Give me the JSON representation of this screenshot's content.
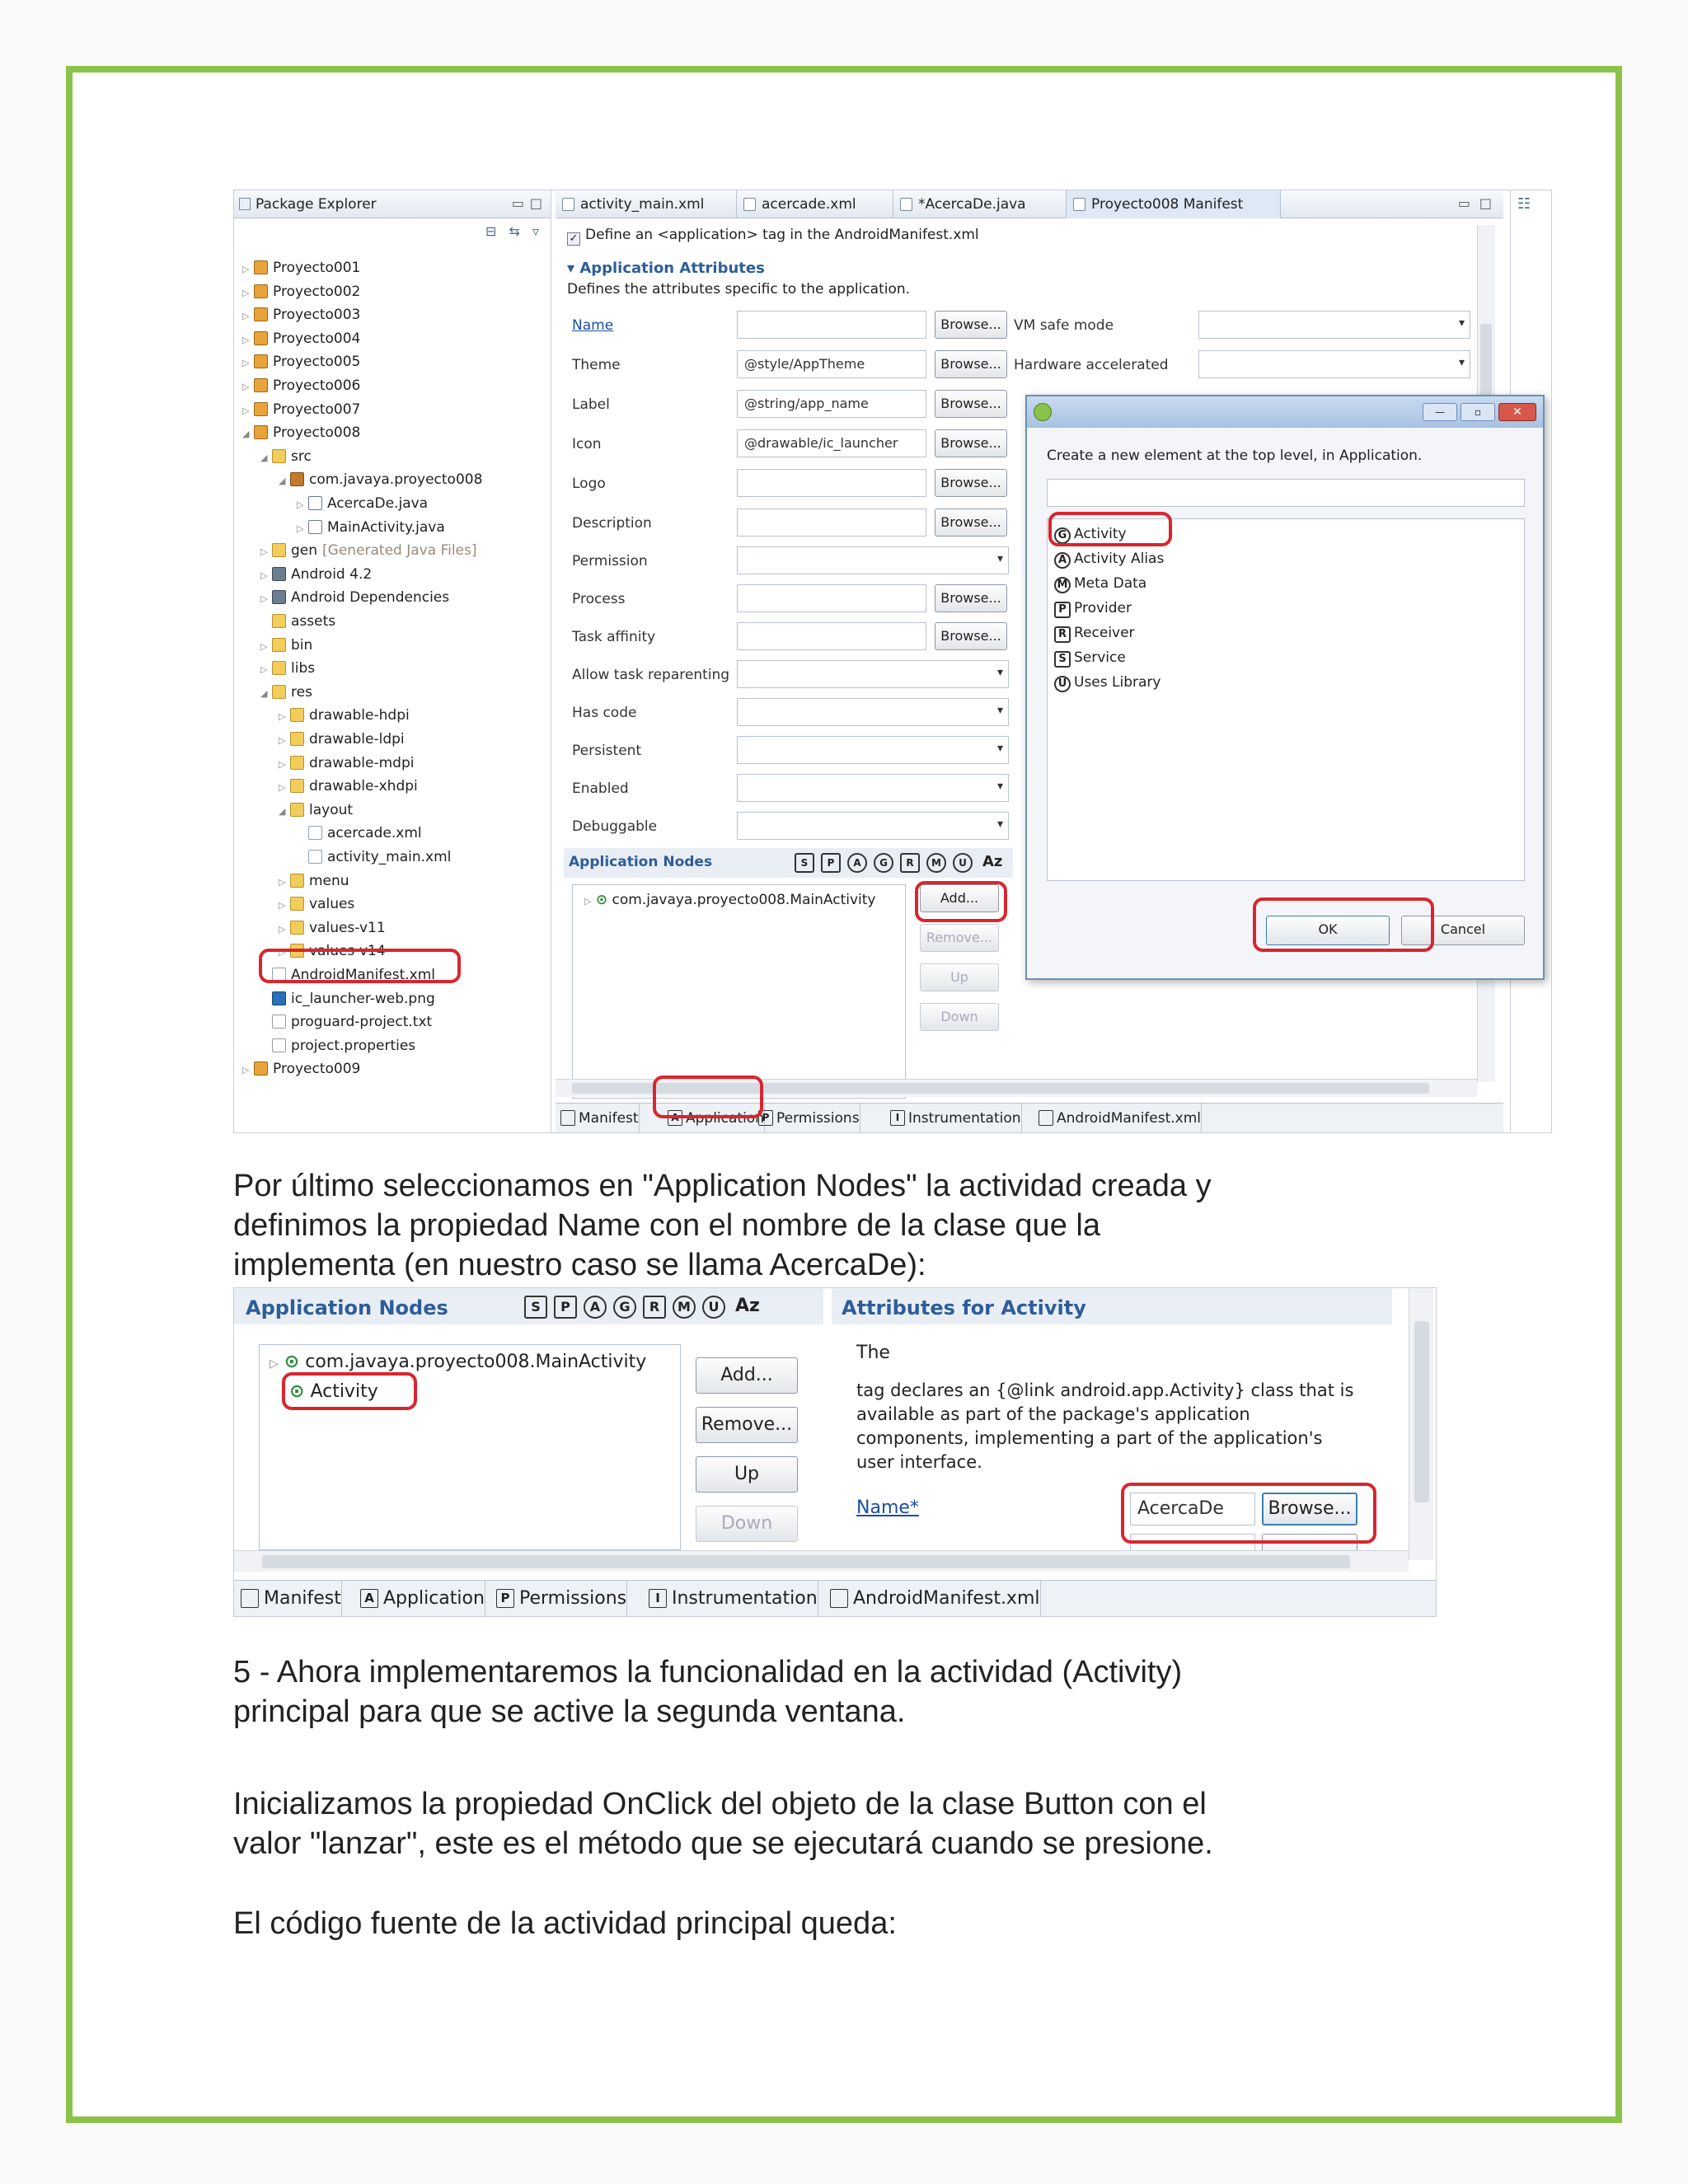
{
  "screenshot1": {
    "package_explorer": {
      "title": "Package Explorer",
      "tree": [
        {
          "label": "Proyecto001",
          "icon": "project-icon",
          "indent": 0,
          "twisty": "▷"
        },
        {
          "label": "Proyecto002",
          "icon": "project-icon",
          "indent": 0,
          "twisty": "▷"
        },
        {
          "label": "Proyecto003",
          "icon": "project-icon",
          "indent": 0,
          "twisty": "▷"
        },
        {
          "label": "Proyecto004",
          "icon": "project-icon",
          "indent": 0,
          "twisty": "▷"
        },
        {
          "label": "Proyecto005",
          "icon": "project-icon",
          "indent": 0,
          "twisty": "▷"
        },
        {
          "label": "Proyecto006",
          "icon": "project-icon",
          "indent": 0,
          "twisty": "▷"
        },
        {
          "label": "Proyecto007",
          "icon": "project-icon",
          "indent": 0,
          "twisty": "▷"
        },
        {
          "label": "Proyecto008",
          "icon": "project-icon",
          "indent": 0,
          "twisty": "◢"
        },
        {
          "label": "src",
          "icon": "folder-icon",
          "indent": 1,
          "twisty": "◢"
        },
        {
          "label": "com.javaya.proyecto008",
          "icon": "package-icon",
          "indent": 2,
          "twisty": "◢"
        },
        {
          "label": "AcercaDe.java",
          "icon": "java-file-icon",
          "indent": 3,
          "twisty": "▷"
        },
        {
          "label": "MainActivity.java",
          "icon": "java-file-icon",
          "indent": 3,
          "twisty": "▷"
        },
        {
          "label": "gen",
          "suffix": "[Generated Java Files]",
          "icon": "folder-icon",
          "indent": 1,
          "twisty": "▷"
        },
        {
          "label": "Android 4.2",
          "icon": "library-icon",
          "indent": 1,
          "twisty": "▷"
        },
        {
          "label": "Android Dependencies",
          "icon": "library-icon",
          "indent": 1,
          "twisty": "▷"
        },
        {
          "label": "assets",
          "icon": "folder-icon",
          "indent": 1,
          "twisty": ""
        },
        {
          "label": "bin",
          "icon": "folder-icon",
          "indent": 1,
          "twisty": "▷"
        },
        {
          "label": "libs",
          "icon": "folder-icon",
          "indent": 1,
          "twisty": "▷"
        },
        {
          "label": "res",
          "icon": "folder-icon",
          "indent": 1,
          "twisty": "◢"
        },
        {
          "label": "drawable-hdpi",
          "icon": "folder-icon",
          "indent": 2,
          "twisty": "▷"
        },
        {
          "label": "drawable-ldpi",
          "icon": "folder-icon",
          "indent": 2,
          "twisty": "▷"
        },
        {
          "label": "drawable-mdpi",
          "icon": "folder-icon",
          "indent": 2,
          "twisty": "▷"
        },
        {
          "label": "drawable-xhdpi",
          "icon": "folder-icon",
          "indent": 2,
          "twisty": "▷"
        },
        {
          "label": "layout",
          "icon": "folder-icon",
          "indent": 2,
          "twisty": "◢"
        },
        {
          "label": "acercade.xml",
          "icon": "xml-file-icon",
          "indent": 3,
          "twisty": ""
        },
        {
          "label": "activity_main.xml",
          "icon": "xml-file-icon",
          "indent": 3,
          "twisty": ""
        },
        {
          "label": "menu",
          "icon": "folder-icon",
          "indent": 2,
          "twisty": "▷"
        },
        {
          "label": "values",
          "icon": "folder-icon",
          "indent": 2,
          "twisty": "▷"
        },
        {
          "label": "values-v11",
          "icon": "folder-icon",
          "indent": 2,
          "twisty": "▷"
        },
        {
          "label": "values-v14",
          "icon": "folder-icon",
          "indent": 2,
          "twisty": "▷"
        },
        {
          "label": "AndroidManifest.xml",
          "icon": "xml-file-icon",
          "indent": 1,
          "twisty": ""
        },
        {
          "label": "ic_launcher-web.png",
          "icon": "image-file-icon",
          "indent": 1,
          "twisty": ""
        },
        {
          "label": "proguard-project.txt",
          "icon": "text-file-icon",
          "indent": 1,
          "twisty": ""
        },
        {
          "label": "project.properties",
          "icon": "text-file-icon",
          "indent": 1,
          "twisty": ""
        },
        {
          "label": "Proyecto009",
          "icon": "project-icon",
          "indent": 0,
          "twisty": "▷"
        }
      ]
    },
    "editor_tabs": [
      "activity_main.xml",
      "acercade.xml",
      "*AcercaDe.java",
      "Proyecto008 Manifest"
    ],
    "define_tag": "Define an <application> tag in the AndroidManifest.xml",
    "section_title": "Application Attributes",
    "section_desc": "Defines the attributes specific to the application.",
    "fields": {
      "name": "Name",
      "theme": "Theme",
      "theme_value": "@style/AppTheme",
      "label": "Label",
      "label_value": "@string/app_name",
      "icon": "Icon",
      "icon_value": "@drawable/ic_launcher",
      "logo": "Logo",
      "description": "Description",
      "permission": "Permission",
      "process": "Process",
      "task_affinity": "Task affinity",
      "allow_task_reparenting": "Allow task reparenting",
      "has_code": "Has code",
      "persistent": "Persistent",
      "enabled": "Enabled",
      "debuggable": "Debuggable"
    },
    "browse": "Browse...",
    "vm_safe_mode": "VM safe mode",
    "hardware_accelerated": "Hardware accelerated",
    "app_nodes": {
      "title": "Application Nodes",
      "badges": [
        "S",
        "P",
        "A",
        "G",
        "R",
        "M",
        "U"
      ],
      "sort": "Az",
      "item": "com.javaya.proyecto008.MainActivity",
      "add": "Add...",
      "remove": "Remove...",
      "up": "Up",
      "down": "Down"
    },
    "dialog": {
      "prompt": "Create a new element at the top level, in Application.",
      "filter_value": "",
      "items": [
        {
          "badge": "G",
          "label": "Activity"
        },
        {
          "badge": "A",
          "label": "Activity Alias"
        },
        {
          "badge": "M",
          "label": "Meta Data"
        },
        {
          "badge": "P",
          "label": "Provider"
        },
        {
          "badge": "R",
          "label": "Receiver"
        },
        {
          "badge": "S",
          "label": "Service"
        },
        {
          "badge": "U",
          "label": "Uses Library"
        }
      ],
      "ok": "OK",
      "cancel": "Cancel"
    },
    "bottom_tabs": [
      "Manifest",
      "Application",
      "Permissions",
      "Instrumentation",
      "AndroidManifest.xml"
    ],
    "bottom_tab_badges": [
      "",
      "A",
      "P",
      "I",
      ""
    ]
  },
  "paragraph1": [
    "Por último seleccionamos en \"Application Nodes\" la actividad creada y",
    "definimos la propiedad Name con el nombre de la clase que la",
    "implementa (en nuestro caso se llama AcercaDe):"
  ],
  "screenshot2": {
    "app_nodes_title": "Application Nodes",
    "badges": [
      "S",
      "P",
      "A",
      "G",
      "R",
      "M",
      "U"
    ],
    "sort": "Az",
    "node_main": "com.javaya.proyecto008.MainActivity",
    "node_activity": "Activity",
    "add": "Add...",
    "remove": "Remove...",
    "up": "Up",
    "down": "Down",
    "attr_title": "Attributes for Activity",
    "attr_the": "The",
    "attr_desc": [
      "tag declares an {@link android.app.Activity} class that is",
      "available as part of the package's application",
      "components, implementing a part of the application's",
      "user interface."
    ],
    "name_label": "Name*",
    "name_value": "AcercaDe",
    "browse": "Browse...",
    "bottom_tabs": [
      "Manifest",
      "Application",
      "Permissions",
      "Instrumentation",
      "AndroidManifest.xml"
    ],
    "bottom_tab_badges": [
      "",
      "A",
      "P",
      "I",
      ""
    ]
  },
  "paragraph2": [
    "5 - Ahora implementaremos la funcionalidad en la actividad (Activity)",
    "principal para que se active la segunda ventana."
  ],
  "paragraph3": [
    "Inicializamos la propiedad OnClick del objeto de la clase Button con el",
    "valor \"lanzar\", este es el método que se ejecutará cuando se presione."
  ],
  "paragraph4": "El código fuente de la actividad principal queda:",
  "colors": {
    "frame": "#8bc34a",
    "highlight": "#d8262f",
    "section_blue": "#2e5d9a"
  }
}
